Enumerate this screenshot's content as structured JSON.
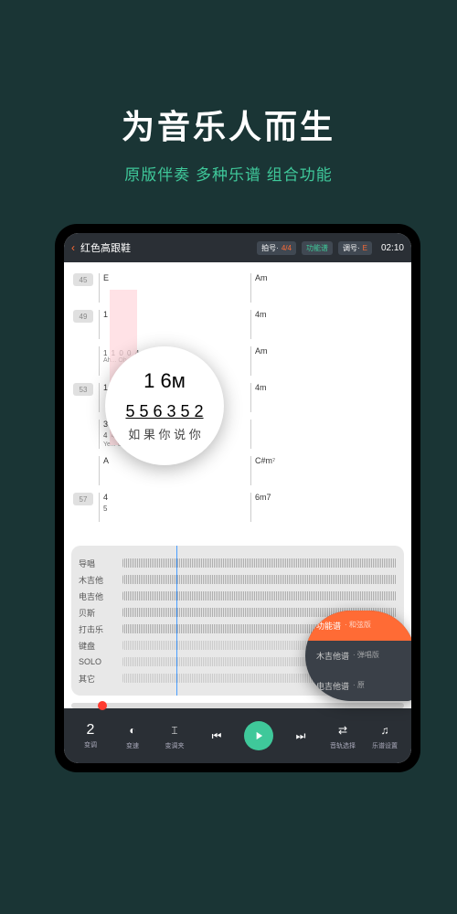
{
  "hero": {
    "title": "为音乐人而生",
    "subtitle": "原版伴奏  多种乐谱  组合功能"
  },
  "topbar": {
    "song_title": "红色高跟鞋",
    "badge1_label": "拍号·",
    "badge1_val": "4/4",
    "badge2_val": "功能谱",
    "badge3_label": "调号·",
    "badge3_val": "E",
    "time": "02:10"
  },
  "score": {
    "rows": [
      {
        "m": "45",
        "cells": [
          {
            "chord": "E",
            "notes": "",
            "lyr": ""
          },
          {
            "chord": "Am",
            "notes": "",
            "lyr": ""
          }
        ]
      },
      {
        "m": "49",
        "cells": [
          {
            "chord": "1",
            "notes": "",
            "lyr": ""
          },
          {
            "chord": "4m",
            "notes": "",
            "lyr": ""
          }
        ]
      },
      {
        "m": "",
        "cells": [
          {
            "chord": "",
            "notes": "1 1   0   0 4 3",
            "lyr": "Ah...              Oh..."
          },
          {
            "chord": "Am",
            "notes": "",
            "lyr": ""
          }
        ]
      },
      {
        "m": "53",
        "cells": [
          {
            "chord": "1",
            "notes": "",
            "lyr": ""
          },
          {
            "chord": "4m",
            "notes": "",
            "lyr": ""
          }
        ]
      },
      {
        "m": "",
        "cells": [
          {
            "chord": "3  5·",
            "notes": "4  4    0 1 4 5  3 2",
            "lyr": "Ye...     oh 你 像 窝 在"
          },
          {
            "chord": "",
            "notes": "",
            "lyr": ""
          }
        ]
      },
      {
        "m": "",
        "cells": [
          {
            "chord": "A",
            "notes": "",
            "lyr": ""
          },
          {
            "chord": "C#m⁷",
            "notes": "",
            "lyr": ""
          }
        ]
      },
      {
        "m": "57",
        "cells": [
          {
            "chord": "4",
            "notes": "5",
            "lyr": ""
          },
          {
            "chord": "6m7",
            "notes": "",
            "lyr": ""
          }
        ]
      }
    ]
  },
  "zoom": {
    "row1": "1        6м",
    "row2": "5   5    6   3 5 2",
    "row3": "如 果 你  说 你"
  },
  "tracks": {
    "items": [
      {
        "label": "导唱",
        "sparse": false
      },
      {
        "label": "木吉他",
        "sparse": false
      },
      {
        "label": "电吉他",
        "sparse": false
      },
      {
        "label": "贝斯",
        "sparse": false
      },
      {
        "label": "打击乐",
        "sparse": false
      },
      {
        "label": "键盘",
        "sparse": true
      },
      {
        "label": "SOLO",
        "sparse": true
      },
      {
        "label": "其它",
        "sparse": true
      }
    ]
  },
  "controls": {
    "transpose_val": "2",
    "transpose": "变调",
    "speed": "变速",
    "tune": "变调夹",
    "track_sel": "音轨选择",
    "score_set": "乐谱设置"
  },
  "popover": {
    "items": [
      {
        "name": "功能谱",
        "sub": "· 和弦版",
        "active": true
      },
      {
        "name": "木吉他谱",
        "sub": "· 弹唱版",
        "active": false
      },
      {
        "name": "电吉他谱",
        "sub": "· 原",
        "active": false
      }
    ]
  }
}
